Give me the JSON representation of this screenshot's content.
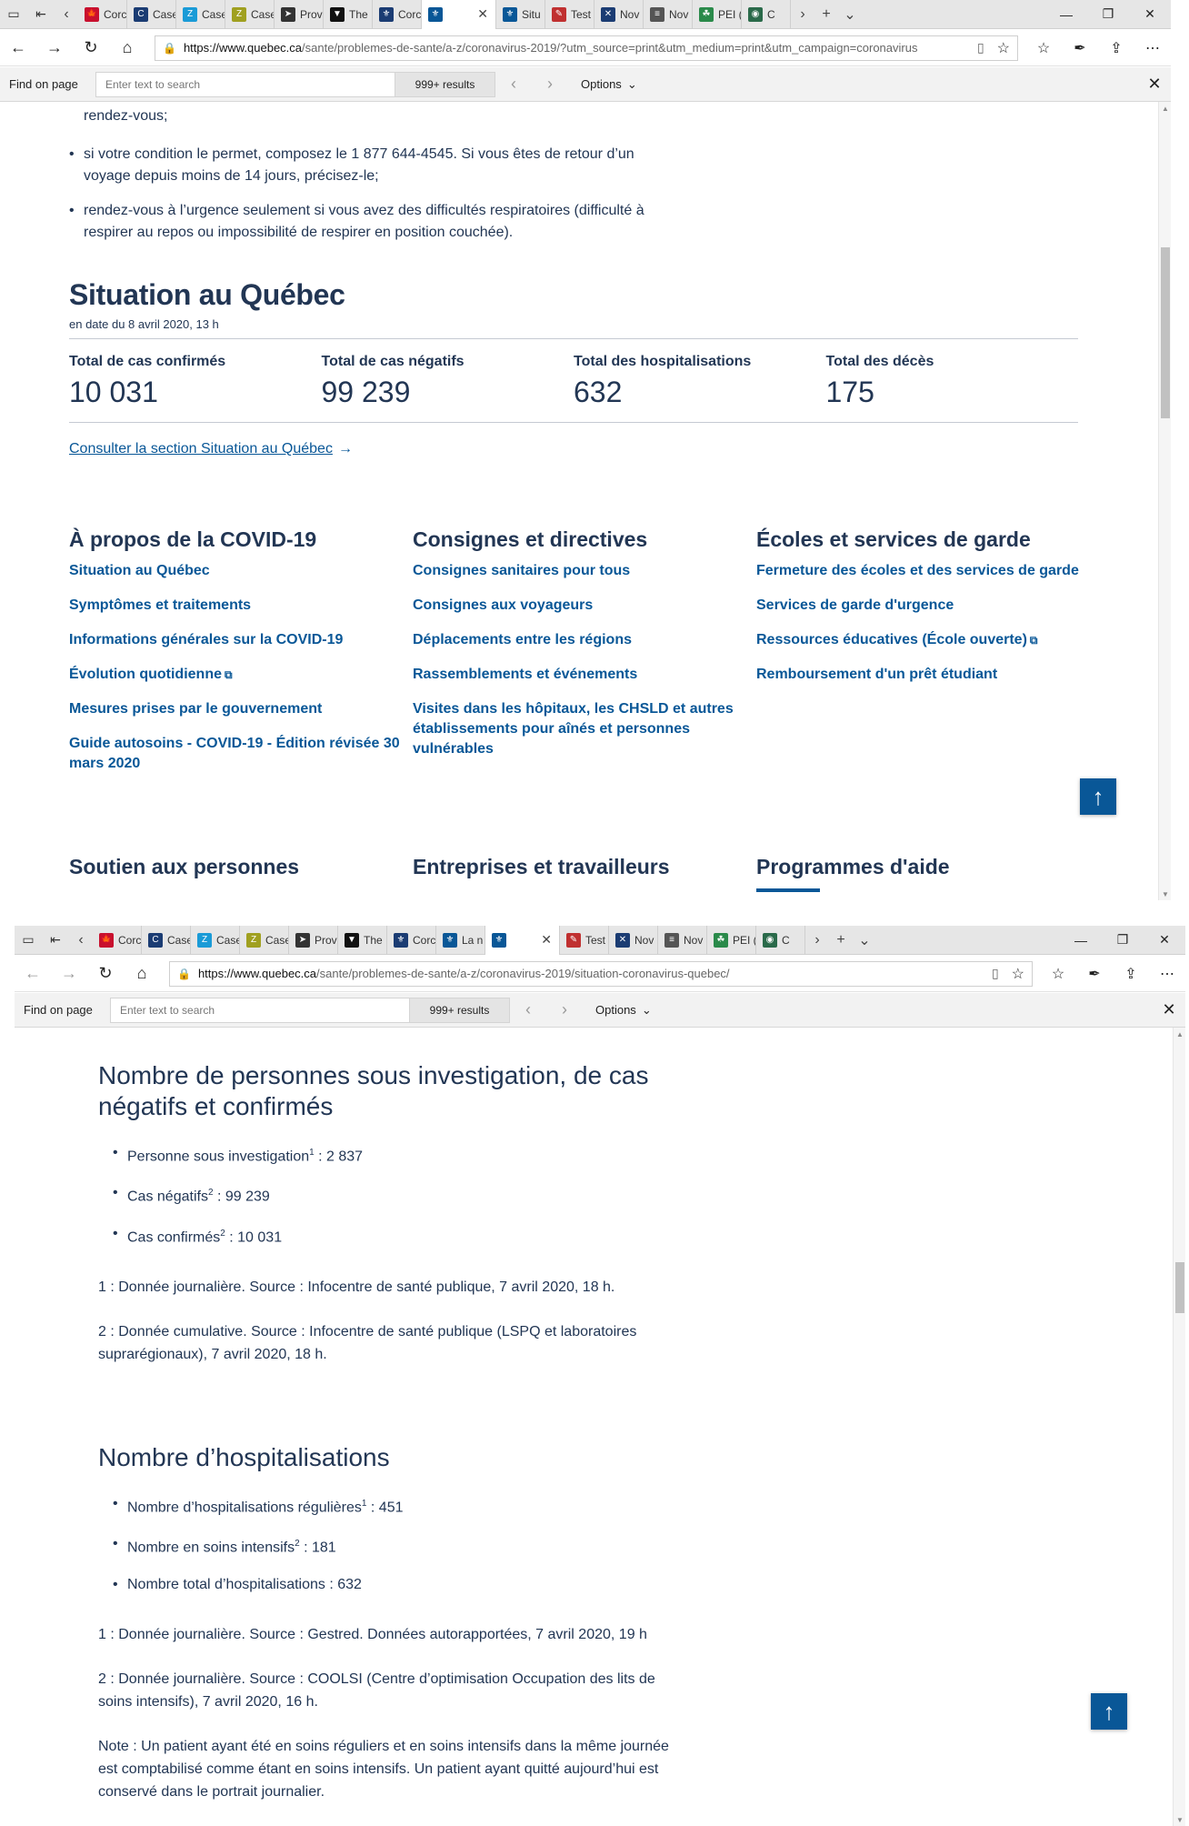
{
  "window1": {
    "tabs": [
      {
        "label": "Corc",
        "color": "#c8102e",
        "glyph": "🍁"
      },
      {
        "label": "Case",
        "color": "#1b3c73",
        "glyph": "C"
      },
      {
        "label": "Case",
        "color": "#1a9bd7",
        "glyph": "Z"
      },
      {
        "label": "Case",
        "color": "#a0a020",
        "glyph": "Z"
      },
      {
        "label": "Prov",
        "color": "#333333",
        "glyph": "➤"
      },
      {
        "label": "The",
        "color": "#111111",
        "glyph": "▼"
      },
      {
        "label": "Corc",
        "color": "#1b3c73",
        "glyph": "⚜"
      },
      {
        "label": "",
        "color": "#095797",
        "glyph": "⚜"
      },
      {
        "label": "Situ",
        "color": "#095797",
        "glyph": "⚜"
      },
      {
        "label": "Test",
        "color": "#c03030",
        "glyph": "✎"
      },
      {
        "label": "Nov",
        "color": "#1b3c73",
        "glyph": "✕"
      },
      {
        "label": "Nov",
        "color": "#555555",
        "glyph": "≡"
      },
      {
        "label": "PEI (",
        "color": "#2a8a4a",
        "glyph": "☘"
      },
      {
        "label": "C",
        "color": "#2a6a4a",
        "glyph": "◉"
      }
    ],
    "url_host": "https://www.quebec.ca",
    "url_path": "/sante/problemes-de-sante/a-z/coronavirus-2019/?utm_source=print&utm_medium=print&utm_campaign=coronavirus",
    "find": {
      "label": "Find on page",
      "placeholder": "Enter text to search",
      "count": "999+ results",
      "options": "Options"
    },
    "bullets": [
      "ne vous présentez pas dans une clinique médicale sans avoir reçu au préalable un rendez-vous;",
      "si votre condition le permet, composez le 1 877 644-4545. Si vous êtes de retour d’un voyage depuis moins de 14 jours, précisez-le;",
      "rendez-vous à l’urgence seulement si vous avez des difficultés respiratoires (difficulté à respirer au repos ou impossibilité de respirer en position couchée)."
    ],
    "situation": {
      "title": "Situation au Québec",
      "date": "en date du 8 avril 2020, 13 h",
      "stats": [
        {
          "label": "Total de cas confirmés",
          "value": "10 031"
        },
        {
          "label": "Total de cas négatifs",
          "value": "99 239"
        },
        {
          "label": "Total des hospitalisations",
          "value": "632"
        },
        {
          "label": "Total des décès",
          "value": "175"
        }
      ],
      "link": "Consulter la section Situation au Québec",
      "link_arrow": "→"
    },
    "columns": [
      {
        "title": "À propos de la COVID-19",
        "links": [
          {
            "text": "Situation au Québec",
            "ext": false
          },
          {
            "text": "Symptômes et traitements",
            "ext": false
          },
          {
            "text": "Informations générales sur la COVID-19",
            "ext": false
          },
          {
            "text": "Évolution quotidienne",
            "ext": true
          },
          {
            "text": "Mesures prises par le gouvernement",
            "ext": false
          },
          {
            "text": "Guide autosoins - COVID-19 - Édition révisée 30 mars 2020",
            "ext": false
          }
        ]
      },
      {
        "title": "Consignes et directives",
        "links": [
          {
            "text": "Consignes sanitaires pour tous",
            "ext": false
          },
          {
            "text": "Consignes aux voyageurs",
            "ext": false
          },
          {
            "text": "Déplacements entre les régions",
            "ext": false
          },
          {
            "text": "Rassemblements et événements",
            "ext": false
          },
          {
            "text": "Visites dans les hôpitaux, les CHSLD et autres établissements pour aînés et personnes vulnérables",
            "ext": false
          }
        ]
      },
      {
        "title": "Écoles et services de garde",
        "links": [
          {
            "text": "Fermeture des écoles et des services de garde",
            "ext": false
          },
          {
            "text": "Services de garde d'urgence",
            "ext": false
          },
          {
            "text": "Ressources éducatives (École ouverte)",
            "ext": true
          },
          {
            "text": "Remboursement d'un prêt étudiant",
            "ext": false
          }
        ]
      }
    ],
    "bottom_titles": [
      "Soutien aux personnes",
      "Entreprises et travailleurs",
      "Programmes d'aide"
    ]
  },
  "window2": {
    "tabs": [
      {
        "label": "Corc",
        "color": "#c8102e",
        "glyph": "🍁"
      },
      {
        "label": "Case",
        "color": "#1b3c73",
        "glyph": "C"
      },
      {
        "label": "Case",
        "color": "#1a9bd7",
        "glyph": "Z"
      },
      {
        "label": "Case",
        "color": "#a0a020",
        "glyph": "Z"
      },
      {
        "label": "Prov",
        "color": "#333333",
        "glyph": "➤"
      },
      {
        "label": "The",
        "color": "#111111",
        "glyph": "▼"
      },
      {
        "label": "Corc",
        "color": "#1b3c73",
        "glyph": "⚜"
      },
      {
        "label": "La n",
        "color": "#095797",
        "glyph": "⚜"
      },
      {
        "label": "",
        "color": "#095797",
        "glyph": "⚜"
      },
      {
        "label": "Test",
        "color": "#c03030",
        "glyph": "✎"
      },
      {
        "label": "Nov",
        "color": "#1b3c73",
        "glyph": "✕"
      },
      {
        "label": "Nov",
        "color": "#555555",
        "glyph": "≡"
      },
      {
        "label": "PEI (",
        "color": "#2a8a4a",
        "glyph": "☘"
      },
      {
        "label": "C",
        "color": "#2a6a4a",
        "glyph": "◉"
      }
    ],
    "url_host": "https://www.quebec.ca",
    "url_path": "/sante/problemes-de-sante/a-z/coronavirus-2019/situation-coronavirus-quebec/",
    "find": {
      "label": "Find on page",
      "placeholder": "Enter text to search",
      "count": "999+ results",
      "options": "Options"
    },
    "section1": {
      "title": "Nombre de personnes sous investigation, de cas négatifs et confirmés",
      "items": [
        {
          "label": "Personne sous investigation",
          "sup": "1",
          "value": " : 2 837"
        },
        {
          "label": "Cas négatifs",
          "sup": "2",
          "value": " : 99 239"
        },
        {
          "label": "Cas confirmés",
          "sup": "2",
          "value": " : 10 031"
        }
      ],
      "notes": [
        "1 : Donnée journalière. Source : Infocentre de santé publique, 7 avril 2020, 18 h.",
        "2 : Donnée cumulative. Source : Infocentre de santé publique (LSPQ et laboratoires suprarégionaux), 7 avril 2020, 18 h."
      ]
    },
    "section2": {
      "title": "Nombre d’hospitalisations",
      "items": [
        {
          "label": "Nombre d’hospitalisations régulières",
          "sup": "1",
          "value": " : 451"
        },
        {
          "label": "Nombre en soins intensifs",
          "sup": "2",
          "value": " : 181"
        },
        {
          "label": "Nombre total d’hospitalisations",
          "sup": "",
          "value": " : 632"
        }
      ],
      "notes": [
        "1 : Donnée journalière. Source : Gestred. Données autorapportées, 7 avril 2020, 19 h",
        "2 : Donnée journalière. Source : COOLSI (Centre d’optimisation Occupation des lits de soins intensifs), 7 avril 2020, 16 h.",
        "Note : Un patient ayant été en soins réguliers et en soins intensifs dans la même journée est comptabilisé comme étant en soins intensifs. Un patient ayant quitté aujourd’hui est conservé dans le portrait journalier."
      ]
    }
  }
}
